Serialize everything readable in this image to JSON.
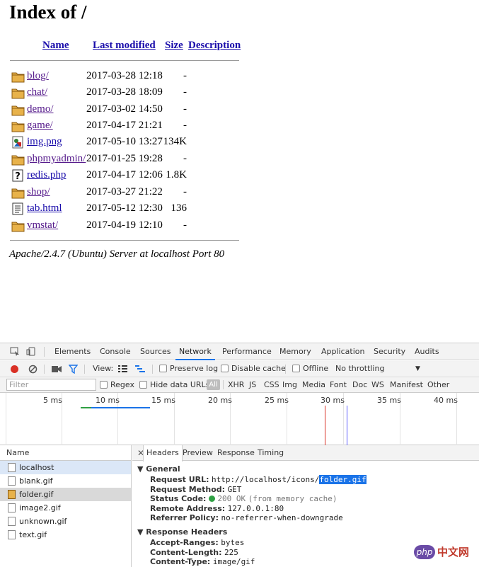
{
  "index": {
    "title": "Index of /",
    "columns": [
      "Name",
      "Last modified",
      "Size",
      "Description"
    ],
    "rows": [
      {
        "icon": "folder-icon",
        "name": "blog/",
        "modified": "2017-03-28 12:18",
        "size": "-"
      },
      {
        "icon": "folder-icon",
        "name": "chat/",
        "modified": "2017-03-28 18:09",
        "size": "-"
      },
      {
        "icon": "folder-icon",
        "name": "demo/",
        "modified": "2017-03-02 14:50",
        "size": "-"
      },
      {
        "icon": "folder-icon",
        "name": "game/",
        "modified": "2017-04-17 21:21",
        "size": "-"
      },
      {
        "icon": "image-icon",
        "name": "img.png",
        "modified": "2017-05-10 13:27",
        "size": "134K"
      },
      {
        "icon": "folder-icon",
        "name": "phpmyadmin/",
        "modified": "2017-01-25 19:28",
        "size": "-"
      },
      {
        "icon": "unknown-file-icon",
        "name": "redis.php",
        "modified": "2017-04-17 12:06",
        "size": "1.8K"
      },
      {
        "icon": "folder-icon",
        "name": "shop/",
        "modified": "2017-03-27 21:22",
        "size": "-"
      },
      {
        "icon": "text-file-icon",
        "name": "tab.html",
        "modified": "2017-05-12 12:30",
        "size": "136"
      },
      {
        "icon": "folder-icon",
        "name": "vmstat/",
        "modified": "2017-04-19 12:10",
        "size": "-"
      }
    ],
    "address": "Apache/2.4.7 (Ubuntu) Server at localhost Port 80"
  },
  "devtools": {
    "tabs": [
      "Elements",
      "Console",
      "Sources",
      "Network",
      "Performance",
      "Memory",
      "Application",
      "Security",
      "Audits"
    ],
    "active_tab": "Network",
    "toolbar": {
      "view_label": "View:",
      "preserve_log": "Preserve log",
      "disable_cache": "Disable cache",
      "offline": "Offline",
      "throttling": "No throttling"
    },
    "filter": {
      "placeholder": "Filter",
      "regex": "Regex",
      "hide_data_urls": "Hide data URLs",
      "types": [
        "All",
        "XHR",
        "JS",
        "CSS",
        "Img",
        "Media",
        "Font",
        "Doc",
        "WS",
        "Manifest",
        "Other"
      ]
    },
    "timeline_labels": [
      "5 ms",
      "10 ms",
      "15 ms",
      "20 ms",
      "25 ms",
      "30 ms",
      "35 ms",
      "40 ms"
    ],
    "requests_header": "Name",
    "requests": [
      "localhost",
      "blank.gif",
      "folder.gif",
      "image2.gif",
      "unknown.gif",
      "text.gif"
    ],
    "detail_tabs": [
      "Headers",
      "Preview",
      "Response",
      "Timing"
    ],
    "general": {
      "title": "General",
      "request_url_label": "Request URL:",
      "request_url_prefix": "http://localhost/icons/",
      "request_url_highlight": "folder.gif",
      "request_method_label": "Request Method:",
      "request_method": "GET",
      "status_code_label": "Status Code:",
      "status_code": "200 OK",
      "status_code_note": "(from memory cache)",
      "remote_address_label": "Remote Address:",
      "remote_address": "127.0.0.1:80",
      "referrer_policy_label": "Referrer Policy:",
      "referrer_policy": "no-referrer-when-downgrade"
    },
    "response_headers": {
      "title": "Response Headers",
      "accept_ranges_label": "Accept-Ranges:",
      "accept_ranges": "bytes",
      "content_length_label": "Content-Length:",
      "content_length": "225",
      "content_type_label": "Content-Type:",
      "content_type": "image/gif"
    }
  },
  "watermark": {
    "logo": "php",
    "text": "中文网"
  },
  "colors": {
    "link": "#1a0dab",
    "visited": "#551a8b",
    "accent": "#1a73e8",
    "record": "#d93025",
    "status_ok": "#2ea043"
  }
}
